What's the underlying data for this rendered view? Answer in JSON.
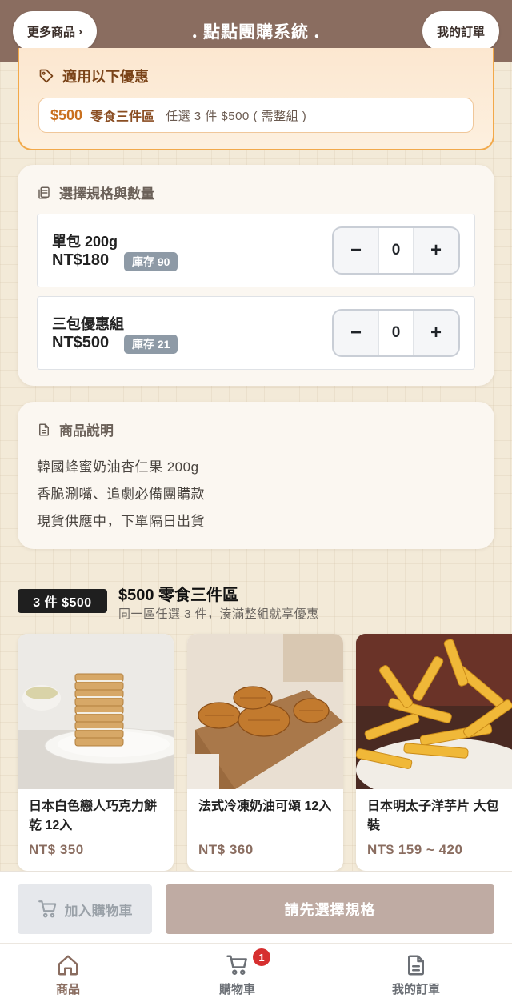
{
  "header": {
    "more_products": "更多商品",
    "title": "點點團購系統",
    "title_dot": ".",
    "my_orders": "我的訂單"
  },
  "coupon": {
    "title": "適用以下優惠",
    "price": "$500",
    "name": "零食三件區",
    "desc": "任選 3 件 $500 ( 需整組 )"
  },
  "spec": {
    "title": "選擇規格與數量",
    "variants": [
      {
        "name": "單包 200g",
        "price": "NT$180",
        "stock": "庫存 90",
        "qty": "0"
      },
      {
        "name": "三包優惠組",
        "price": "NT$500",
        "stock": "庫存 21",
        "qty": "0"
      }
    ],
    "minus": "−",
    "plus": "+"
  },
  "description": {
    "title": "商品說明",
    "lines": [
      "韓國蜂蜜奶油杏仁果 200g",
      "香脆涮嘴、追劇必備團購款",
      "現貨供應中，下單隔日出貨"
    ]
  },
  "bundle": {
    "badge": "3 件 $500",
    "title": "$500 零食三件區",
    "subtitle": "同一區任選 3 件，湊滿整組就享優惠"
  },
  "products": [
    {
      "name": "日本白色戀人巧克力餅乾 12入",
      "price": "NT$ 350"
    },
    {
      "name": "法式冷凍奶油可頌 12入",
      "price": "NT$ 360"
    },
    {
      "name": "日本明太子洋芋片 大包裝",
      "price": "NT$ 159 ~ 420"
    }
  ],
  "actions": {
    "add_to_cart": "加入購物車",
    "select_spec": "請先選擇規格"
  },
  "nav": {
    "home": "商品",
    "cart": "購物車",
    "cart_count": "1",
    "orders": "我的訂單"
  },
  "colors": {
    "header_bg": "#8a6d60",
    "coupon_border": "#f2a94a",
    "primary_disabled": "#bfaba3",
    "badge_red": "#d62f2f"
  },
  "icons": {
    "coupon": "tag-icon",
    "spec": "clipboard-icon",
    "description": "document-icon",
    "add_to_cart": "cart-icon",
    "nav_home": "home-icon",
    "nav_cart": "cart-icon",
    "nav_orders": "document-icon"
  }
}
